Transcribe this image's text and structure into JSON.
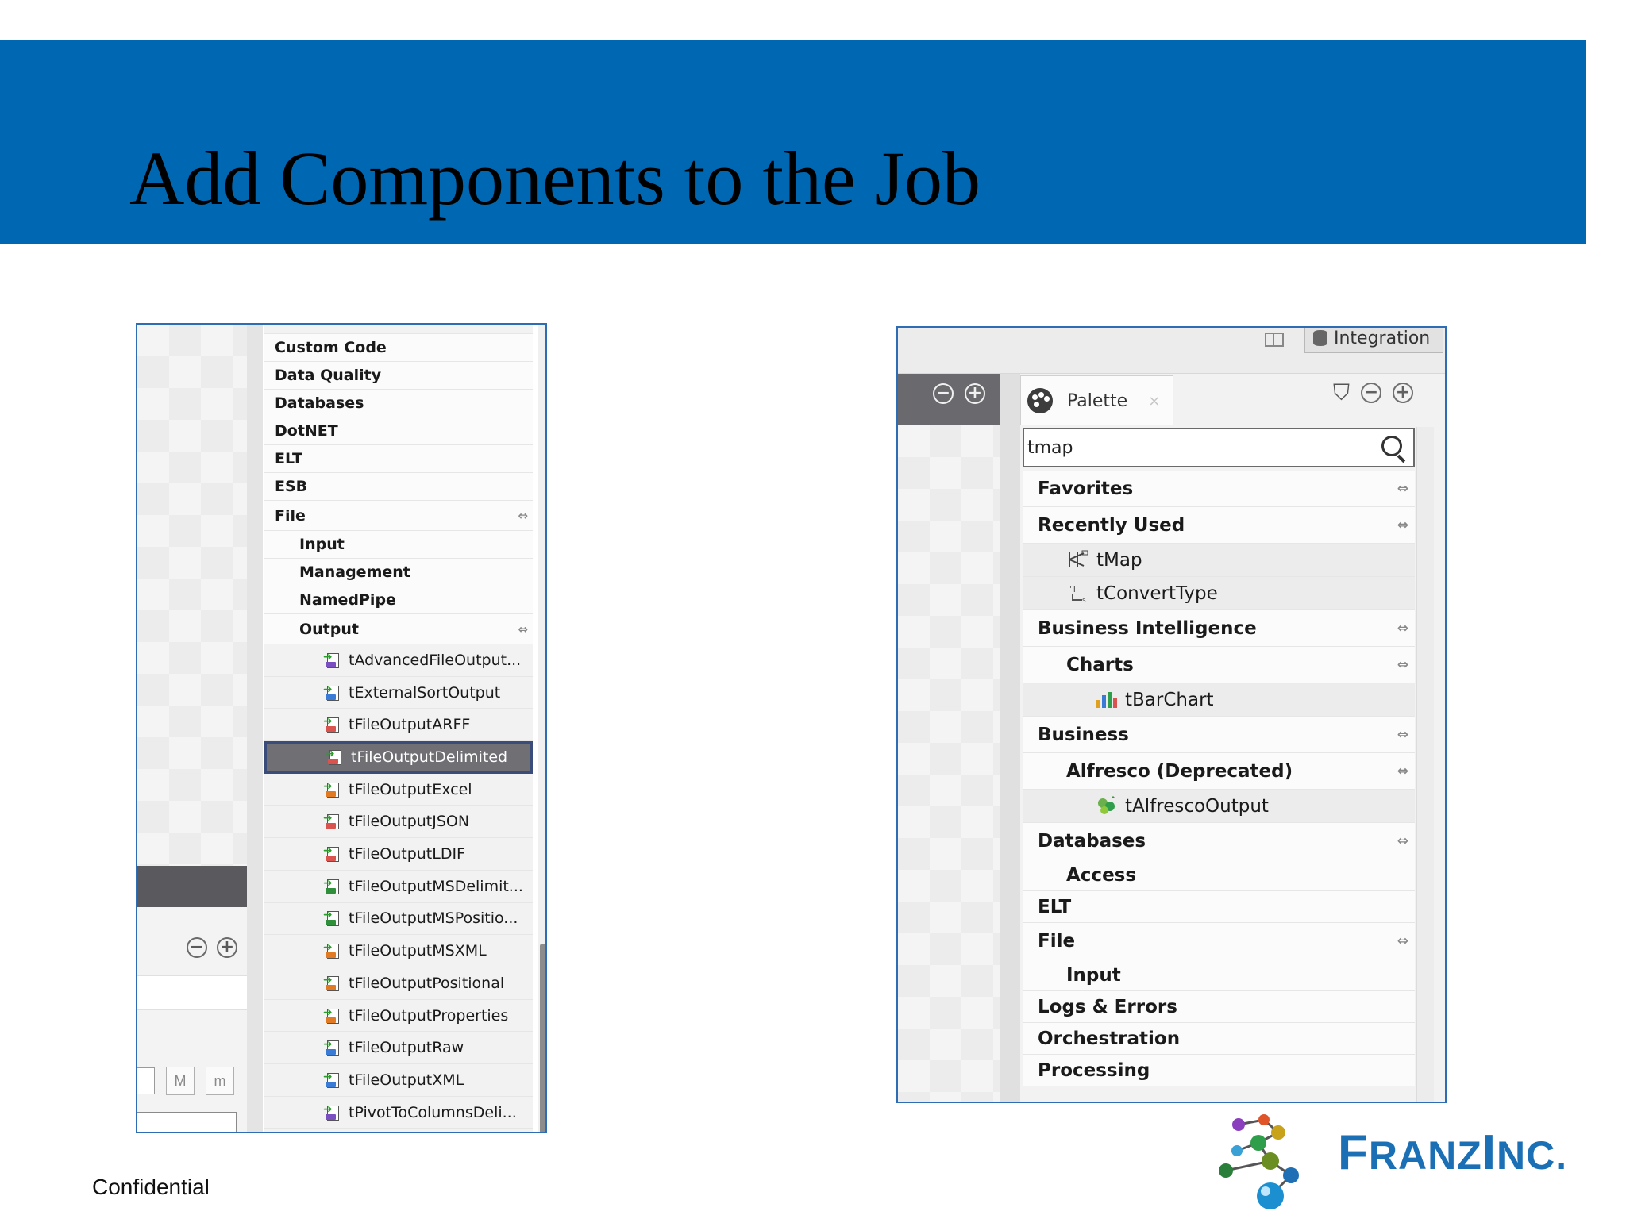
{
  "slide": {
    "title": "Add Components to the Job",
    "footer": "Confidential",
    "logo_text_big1": "F",
    "logo_text_small1": "RANZ",
    "logo_text_big2": "I",
    "logo_text_small2": "NC.",
    "header_color": "#0068b2"
  },
  "left_panel": {
    "categories_top": [
      "Custom Code",
      "Data Quality",
      "Databases",
      "DotNET",
      "ELT",
      "ESB",
      "File"
    ],
    "file_subcategories": [
      "Input",
      "Management",
      "NamedPipe",
      "Output"
    ],
    "output_components": [
      "tAdvancedFileOutput...",
      "tExternalSortOutput",
      "tFileOutputARFF",
      "tFileOutputDelimited",
      "tFileOutputExcel",
      "tFileOutputJSON",
      "tFileOutputLDIF",
      "tFileOutputMSDelimit...",
      "tFileOutputMSPositio...",
      "tFileOutputMSXML",
      "tFileOutputPositional",
      "tFileOutputProperties",
      "tFileOutputRaw",
      "tFileOutputXML",
      "tPivotToColumnsDeli..."
    ],
    "selected_component": "tFileOutputDelimited",
    "button_M": "M",
    "button_m": "m",
    "zoom_out": "−",
    "zoom_in": "+",
    "toggle_glyph": "⇔"
  },
  "right_panel": {
    "perspective_label": "Integration",
    "tab_label": "Palette",
    "tab_close": "×",
    "search_value": "tmap",
    "zoom_out": "−",
    "zoom_in": "+",
    "toggle_glyph": "⇔",
    "filter_glyph": "⛉",
    "rows": [
      {
        "text": "Favorites",
        "kind": "cat",
        "indent": 0,
        "toggle": true
      },
      {
        "text": "Recently Used",
        "kind": "cat",
        "indent": 0,
        "toggle": true
      },
      {
        "text": "tMap",
        "kind": "comp",
        "indent": 1,
        "icon": "tmap-icon"
      },
      {
        "text": "tConvertType",
        "kind": "comp",
        "indent": 1,
        "icon": "convert-type-icon"
      },
      {
        "text": "Business Intelligence",
        "kind": "cat",
        "indent": 0,
        "toggle": true
      },
      {
        "text": "Charts",
        "kind": "cat",
        "indent": 1,
        "toggle": true
      },
      {
        "text": "tBarChart",
        "kind": "comp",
        "indent": 2,
        "icon": "bar-chart-icon"
      },
      {
        "text": "Business",
        "kind": "cat",
        "indent": 0,
        "toggle": true
      },
      {
        "text": "Alfresco (Deprecated)",
        "kind": "cat",
        "indent": 1,
        "toggle": true
      },
      {
        "text": "tAlfrescoOutput",
        "kind": "comp",
        "indent": 2,
        "icon": "alfresco-icon"
      },
      {
        "text": "Databases",
        "kind": "cat",
        "indent": 0,
        "toggle": true
      },
      {
        "text": "Access",
        "kind": "cat",
        "indent": 1,
        "toggle": false
      },
      {
        "text": "ELT",
        "kind": "cat",
        "indent": 0,
        "toggle": false
      },
      {
        "text": "File",
        "kind": "cat",
        "indent": 0,
        "toggle": true
      },
      {
        "text": "Input",
        "kind": "cat",
        "indent": 1,
        "toggle": false
      },
      {
        "text": "Logs & Errors",
        "kind": "cat",
        "indent": 0,
        "toggle": false
      },
      {
        "text": "Orchestration",
        "kind": "cat",
        "indent": 0,
        "toggle": false
      },
      {
        "text": "Processing",
        "kind": "cat",
        "indent": 0,
        "toggle": false
      }
    ]
  }
}
